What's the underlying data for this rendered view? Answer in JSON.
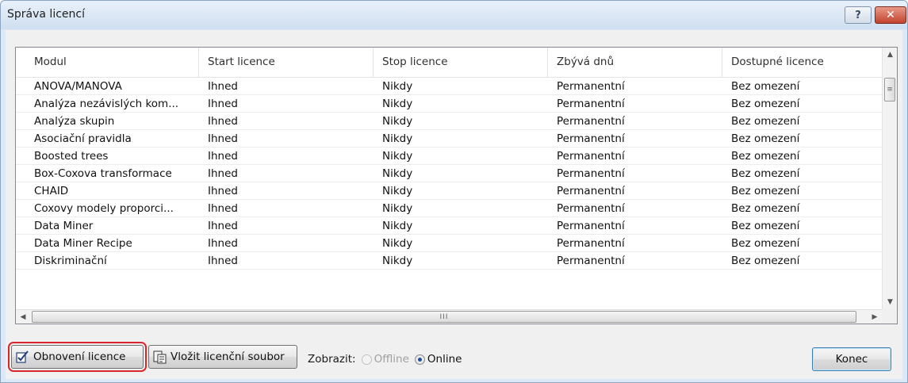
{
  "window": {
    "title": "Správa licencí",
    "help_glyph": "?",
    "close_glyph": "✕"
  },
  "table": {
    "columns": [
      "Modul",
      "Start licence",
      "Stop licence",
      "Zbývá dnů",
      "Dostupné licence"
    ],
    "rows": [
      [
        "ANOVA/MANOVA",
        "Ihned",
        "Nikdy",
        "Permanentní",
        "Bez omezení"
      ],
      [
        "Analýza nezávislých kom...",
        "Ihned",
        "Nikdy",
        "Permanentní",
        "Bez omezení"
      ],
      [
        "Analýza skupin",
        "Ihned",
        "Nikdy",
        "Permanentní",
        "Bez omezení"
      ],
      [
        "Asociační pravidla",
        "Ihned",
        "Nikdy",
        "Permanentní",
        "Bez omezení"
      ],
      [
        "Boosted trees",
        "Ihned",
        "Nikdy",
        "Permanentní",
        "Bez omezení"
      ],
      [
        "Box-Coxova transformace",
        "Ihned",
        "Nikdy",
        "Permanentní",
        "Bez omezení"
      ],
      [
        "CHAID",
        "Ihned",
        "Nikdy",
        "Permanentní",
        "Bez omezení"
      ],
      [
        "Coxovy modely proporci...",
        "Ihned",
        "Nikdy",
        "Permanentní",
        "Bez omezení"
      ],
      [
        "Data Miner",
        "Ihned",
        "Nikdy",
        "Permanentní",
        "Bez omezení"
      ],
      [
        "Data Miner Recipe",
        "Ihned",
        "Nikdy",
        "Permanentní",
        "Bez omezení"
      ],
      [
        "Diskriminační",
        "Ihned",
        "Nikdy",
        "Permanentní",
        "Bez omezení"
      ]
    ]
  },
  "scroll": {
    "up_icon": "scroll-up-arrow",
    "down_icon": "scroll-down-arrow",
    "left_icon": "scroll-left-arrow",
    "right_icon": "scroll-right-arrow"
  },
  "footer": {
    "renew_button": "Obnovení licence",
    "insert_button": "Vložit licenční soubor",
    "show_label": "Zobrazit:",
    "option_offline": "Offline",
    "option_online": "Online",
    "selected_option": "Online",
    "end_button": "Konec"
  },
  "colors": {
    "highlight_outline": "#d9262a",
    "title_bar": "#cfdff0",
    "close_button": "#c2432d"
  }
}
